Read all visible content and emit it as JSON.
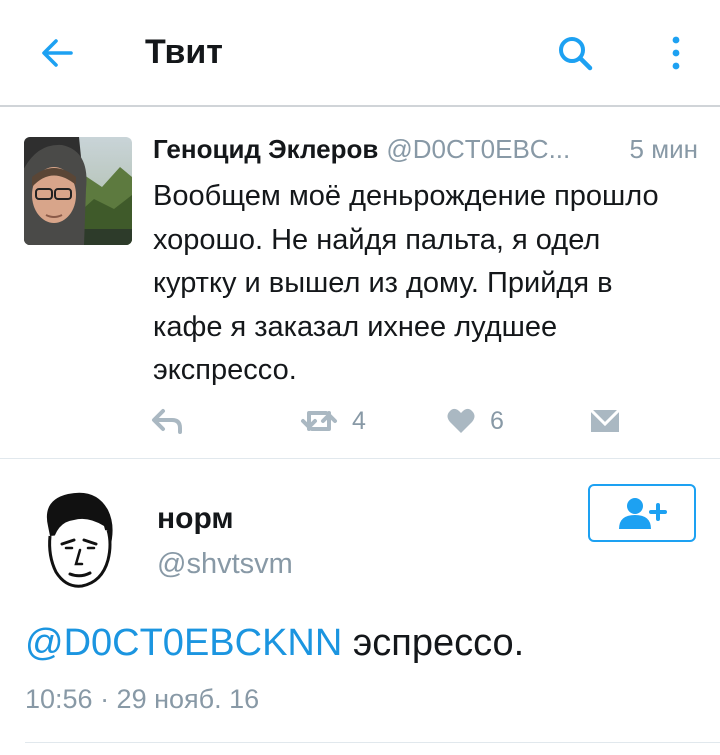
{
  "header": {
    "title": "Твит",
    "back_icon": "arrow-left-icon",
    "search_icon": "search-icon",
    "more_icon": "more-vertical-icon"
  },
  "colors": {
    "accent": "#1da1f2",
    "mention": "#1b95e0",
    "muted": "#8899a6",
    "action_icon": "#aab8c2"
  },
  "tweet": {
    "author_name": "Геноцид Эклеров",
    "author_handle": "@D0CT0EBC...",
    "time": "5 мин",
    "text": "Вообщем моё деньрождение прошло хорошо. Не найдя пальта, я одел куртку и вышел из дому. Прийдя в кафе я заказал ихнее лудшее экспрессо.",
    "actions": {
      "reply_icon": "reply-icon",
      "retweet_icon": "retweet-icon",
      "retweet_count": "4",
      "like_icon": "heart-icon",
      "like_count": "6",
      "dm_icon": "envelope-icon"
    }
  },
  "reply": {
    "author_name": "норм",
    "author_handle": "@shvtsvm",
    "follow_icon": "follow-user-icon",
    "mention": "@D0CT0EBCKNN",
    "text": " эспрессо.",
    "timestamp": "10:56 · 29 нояб. 16"
  }
}
